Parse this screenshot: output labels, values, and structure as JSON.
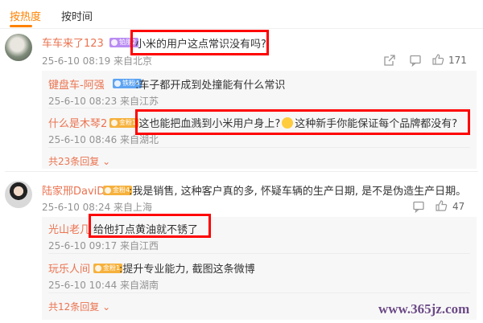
{
  "tabs": {
    "hot": "按热度",
    "time": "按时间"
  },
  "thread1": {
    "user": "车车来了123",
    "badge": "铂朋2",
    "text": "小米的用户这点常识没有吗?",
    "time": "25-6-10 08:19 来自北京",
    "likes": "171",
    "replies": [
      {
        "user": "键盘车-阿强",
        "badge": "铁粉4",
        "text": ":车子都开成到处撞能有什么常识",
        "time": "25-6-10 08:23 来自江苏"
      },
      {
        "user": "什么是木琴2",
        "badge": "金粉1",
        "text_a": ":这也能把血溅到小米用户身上?",
        "text_b": "这种新手你能保证每个品牌都没有?",
        "time": "25-6-10 08:46 来自湖北"
      }
    ],
    "expand": "共23条回复"
  },
  "thread2": {
    "user": "陆家邢DaviD",
    "badge": "金粉4",
    "text": ":我是销售, 这种客户真的多, 怀疑车辆的生产日期, 是不是伪造生产日期。",
    "time": "25-6-10 08:24 来自上海",
    "likes": "47",
    "replies": [
      {
        "user": "光山老几",
        "text": "给他打点黄油就不锈了",
        "time": "25-6-10 09:17 来自江西"
      },
      {
        "user": "玩乐人间",
        "badge": "金粉1",
        "text": ":提升专业能力, 截图这条微博",
        "time": "25-6-10 10:44 来自湖南"
      }
    ],
    "expand": "共12条回复"
  },
  "watermark": "www.365jz.com",
  "colors": {
    "accent": "#ff8200",
    "username": "#eb7350",
    "highlight": "#ff0000"
  }
}
